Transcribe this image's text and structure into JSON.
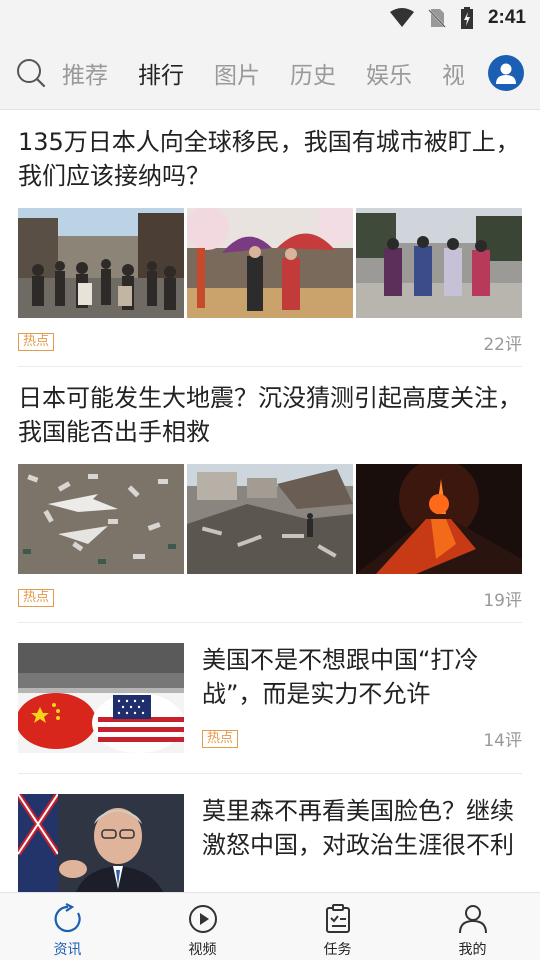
{
  "status_bar": {
    "time": "2:41"
  },
  "top_nav": {
    "tabs": [
      {
        "label": "推荐"
      },
      {
        "label": "排行"
      },
      {
        "label": "图片"
      },
      {
        "label": "历史"
      },
      {
        "label": "娱乐"
      },
      {
        "label": "视"
      }
    ],
    "active_tab": "排行"
  },
  "feed": [
    {
      "title": "135万日本人向全球移民，我国有城市被盯上，我们应该接纳吗？",
      "tag": "热点",
      "comments": "22评",
      "images": [
        "crowded-street-photo",
        "kimono-umbrella-photo",
        "kimono-walkers-photo"
      ]
    },
    {
      "title": "日本可能发生大地震？沉没猜测引起高度关注，我国能否出手相救",
      "tag": "热点",
      "comments": "19评",
      "images": [
        "tsunami-aerial-photo",
        "earthquake-rubble-photo",
        "volcano-eruption-photo"
      ]
    },
    {
      "title": "美国不是不想跟中国“打冷战”，而是实力不允许",
      "tag": "热点",
      "comments": "14评",
      "images": [
        "boxing-gloves-flags-photo"
      ]
    },
    {
      "title": "莫里森不再看美国脸色？继续激怒中国，对政治生涯很不利",
      "images": [
        "politician-speaking-photo"
      ]
    }
  ],
  "bottom_nav": {
    "items": [
      {
        "label": "资讯",
        "icon": "refresh-circle-icon"
      },
      {
        "label": "视频",
        "icon": "play-circle-icon"
      },
      {
        "label": "任务",
        "icon": "task-list-icon"
      },
      {
        "label": "我的",
        "icon": "person-icon"
      }
    ]
  },
  "colors": {
    "accent": "#1a5fb4",
    "tag": "#e39a4a",
    "muted": "#999999"
  }
}
